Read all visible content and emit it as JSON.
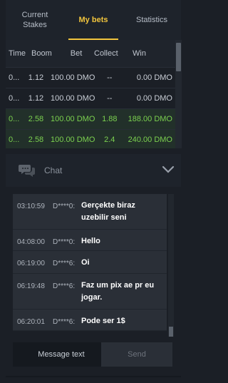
{
  "tabs": [
    {
      "label": "Current\nStakes"
    },
    {
      "label": "My bets"
    },
    {
      "label": "Statistics"
    }
  ],
  "table": {
    "headers": [
      "Time",
      "Boom",
      "Bet",
      "Collect",
      "Win"
    ],
    "rows": [
      {
        "time": "0...",
        "boom": "1.12",
        "bet": "100.00 DMO",
        "collect": "--",
        "win": "0.00 DMO",
        "won": false
      },
      {
        "time": "0...",
        "boom": "1.12",
        "bet": "100.00 DMO",
        "collect": "--",
        "win": "0.00 DMO",
        "won": false
      },
      {
        "time": "0...",
        "boom": "2.58",
        "bet": "100.00 DMO",
        "collect": "1.88",
        "win": "188.00 DMO",
        "won": true
      },
      {
        "time": "0...",
        "boom": "2.58",
        "bet": "100.00 DMO",
        "collect": "2.4",
        "win": "240.00 DMO",
        "won": true
      }
    ]
  },
  "chat": {
    "title": "Chat",
    "messages": [
      {
        "time": "03:10:59",
        "user": "D****0:",
        "text": "Gerçekte biraz uzebilir seni"
      },
      {
        "time": "04:08:00",
        "user": "D****0:",
        "text": "Hello"
      },
      {
        "time": "06:19:00",
        "user": "D****6:",
        "text": "Oi"
      },
      {
        "time": "06:19:48",
        "user": "D****6:",
        "text": "Faz um pix ae pr eu jogar."
      },
      {
        "time": "06:20:01",
        "user": "D****6:",
        "text": "Pode ser 1$"
      }
    ],
    "input_placeholder": "Message text",
    "send_label": "Send"
  },
  "colors": {
    "accent": "#f2c53d",
    "win": "#7bd04f",
    "background": "#1b1f26"
  }
}
